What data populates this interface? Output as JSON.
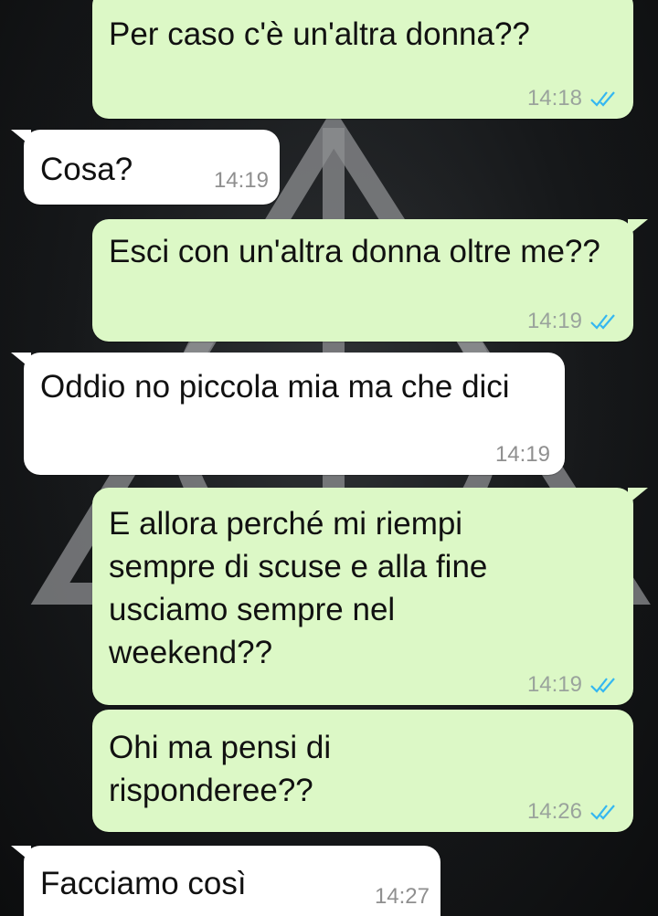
{
  "colors": {
    "outgoing_bubble": "#dcf8c6",
    "incoming_bubble": "#ffffff",
    "read_ticks": "#34b7f1"
  },
  "messages": [
    {
      "direction": "outgoing",
      "text": "Per caso c'è un'altra donna??",
      "time": "14:18",
      "status": "read"
    },
    {
      "direction": "incoming",
      "text": "Cosa?",
      "time": "14:19"
    },
    {
      "direction": "outgoing",
      "text": "Esci con un'altra donna oltre me??",
      "time": "14:19",
      "status": "read"
    },
    {
      "direction": "incoming",
      "text": "Oddio no piccola mia ma che dici",
      "time": "14:19"
    },
    {
      "direction": "outgoing",
      "text": "E allora perché mi riempi sempre di scuse e alla fine usciamo sempre nel weekend??",
      "time": "14:19",
      "status": "read"
    },
    {
      "direction": "outgoing",
      "text": "Ohi ma pensi di risponderee??",
      "time": "14:26",
      "status": "read"
    },
    {
      "direction": "incoming",
      "text": "Facciamo così",
      "time": "14:27"
    }
  ]
}
